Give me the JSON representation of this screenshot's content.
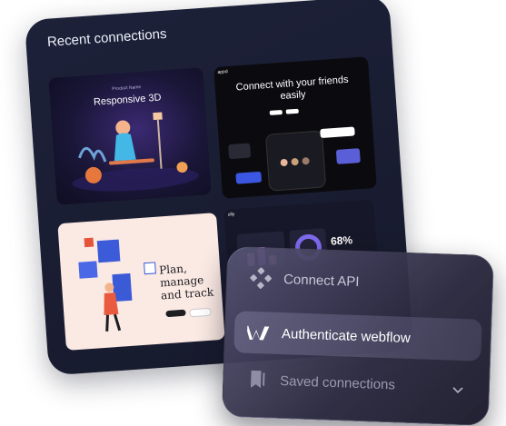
{
  "recent": {
    "title": "Recent connections"
  },
  "thumbnails": [
    {
      "small": "Product Name",
      "big": "Responsive 3D"
    },
    {
      "brand": "appd",
      "headline": "Connect with your friends easily"
    },
    {
      "headline": "Plan, manage and track"
    },
    {
      "brand": "ully",
      "stat": "68%"
    }
  ],
  "menu": {
    "items": [
      {
        "label": "Connect API",
        "icon": "api-nodes-icon"
      },
      {
        "label": "Authenticate webflow",
        "icon": "webflow-logo-icon"
      },
      {
        "label": "Saved connections",
        "icon": "bookmark-icon"
      }
    ],
    "expand_icon": "chevron-down-icon"
  }
}
